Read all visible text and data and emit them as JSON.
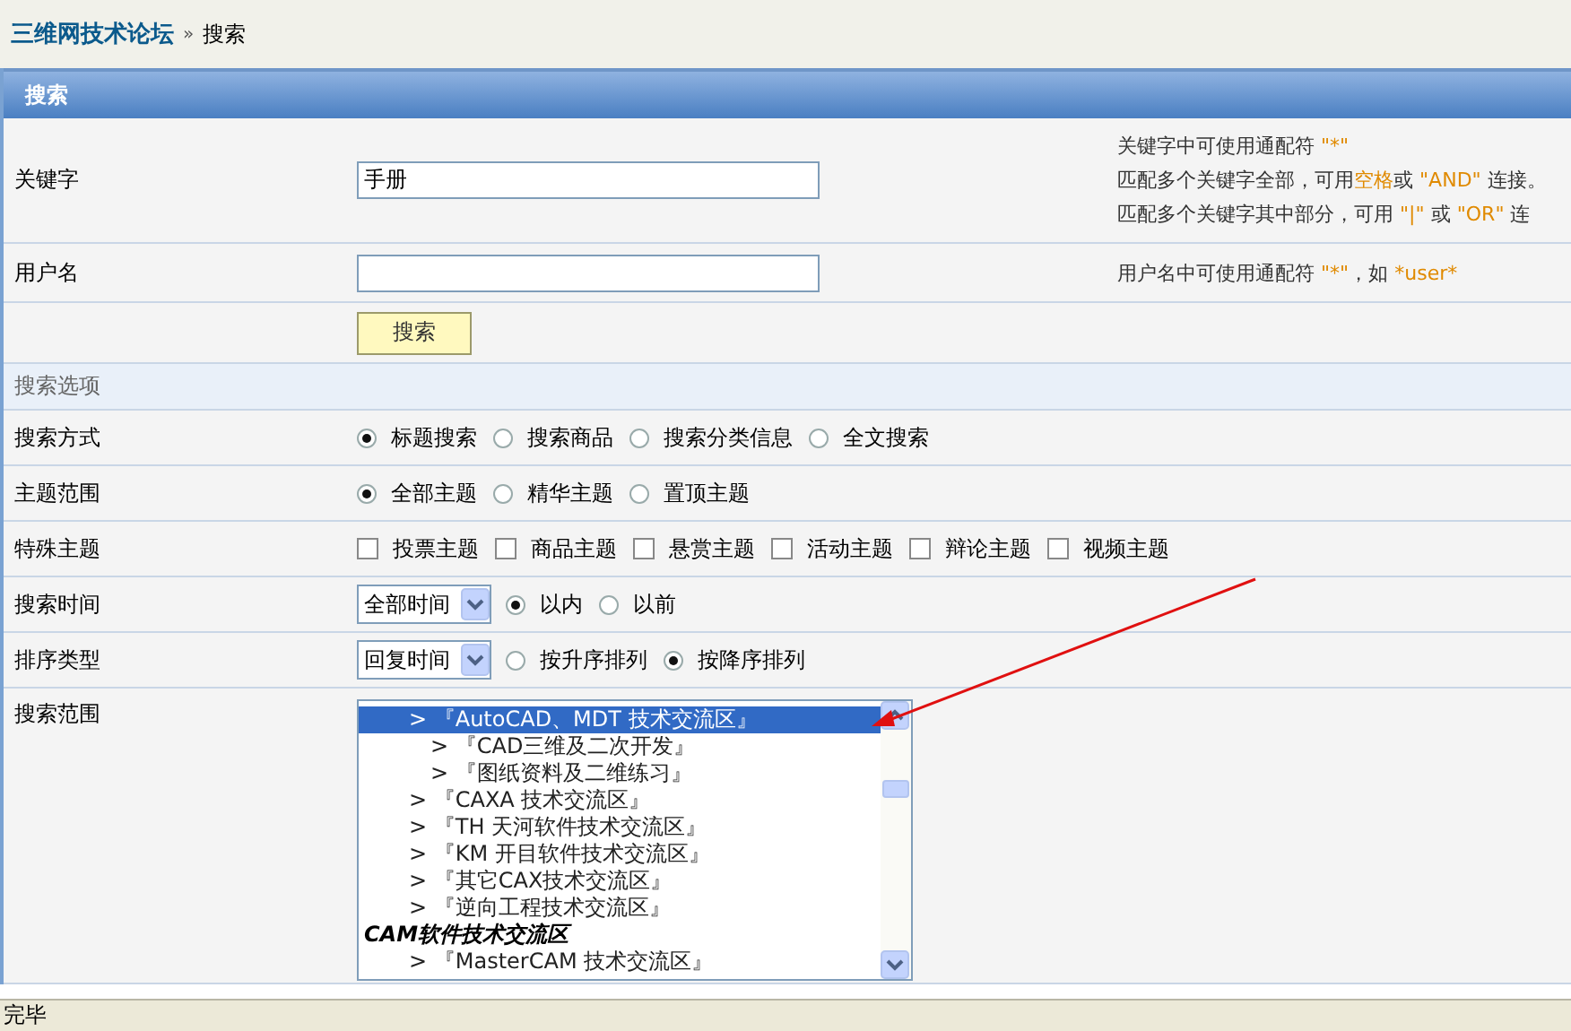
{
  "breadcrumb": {
    "site": "三维网技术论坛",
    "separator": "»",
    "current": "搜索"
  },
  "panel": {
    "title": "搜索"
  },
  "keyword": {
    "label": "关键字",
    "value": "手册",
    "hints": [
      [
        {
          "text": "关键字中可使用通配符 ",
          "highlight": false
        },
        {
          "text": "\"*\"",
          "highlight": true
        }
      ],
      [
        {
          "text": "匹配多个关键字全部，可用",
          "highlight": false
        },
        {
          "text": "空格",
          "highlight": true
        },
        {
          "text": "或 ",
          "highlight": false
        },
        {
          "text": "\"AND\"",
          "highlight": true
        },
        {
          "text": " 连接。",
          "highlight": false
        }
      ],
      [
        {
          "text": "匹配多个关键字其中部分，可用 ",
          "highlight": false
        },
        {
          "text": "\"|\"",
          "highlight": true
        },
        {
          "text": " 或 ",
          "highlight": false
        },
        {
          "text": "\"OR\"",
          "highlight": true
        },
        {
          "text": " 连",
          "highlight": false
        }
      ]
    ]
  },
  "username": {
    "label": "用户名",
    "hints": [
      [
        {
          "text": "用户名中可使用通配符 ",
          "highlight": false
        },
        {
          "text": "\"*\"",
          "highlight": true
        },
        {
          "text": "，如 ",
          "highlight": false
        },
        {
          "text": "*user*",
          "highlight": true
        }
      ]
    ]
  },
  "search_button": "搜索",
  "options": {
    "title": "搜索选项",
    "rows": [
      {
        "label": "搜索方式",
        "kind": "radio",
        "choices": [
          {
            "label": "标题搜索",
            "selected": true
          },
          {
            "label": "搜索商品",
            "selected": false
          },
          {
            "label": "搜索分类信息",
            "selected": false
          },
          {
            "label": "全文搜索",
            "selected": false
          }
        ]
      },
      {
        "label": "主题范围",
        "kind": "radio",
        "choices": [
          {
            "label": "全部主题",
            "selected": true
          },
          {
            "label": "精华主题",
            "selected": false
          },
          {
            "label": "置顶主题",
            "selected": false
          }
        ]
      },
      {
        "label": "特殊主题",
        "kind": "checkbox",
        "choices": [
          {
            "label": "投票主题",
            "checked": false
          },
          {
            "label": "商品主题",
            "checked": false
          },
          {
            "label": "悬赏主题",
            "checked": false
          },
          {
            "label": "活动主题",
            "checked": false
          },
          {
            "label": "辩论主题",
            "checked": false
          },
          {
            "label": "视频主题",
            "checked": false
          }
        ]
      },
      {
        "label": "搜索时间",
        "kind": "select-radio",
        "select": "全部时间",
        "choices": [
          {
            "label": "以内",
            "selected": true
          },
          {
            "label": "以前",
            "selected": false
          }
        ]
      },
      {
        "label": "排序类型",
        "kind": "select-radio",
        "select": "回复时间",
        "choices": [
          {
            "label": "按升序排列",
            "selected": false
          },
          {
            "label": "按降序排列",
            "selected": true
          }
        ]
      },
      {
        "label": "搜索范围",
        "kind": "listbox",
        "items": [
          {
            "text": "> 『AutoCAD、MDT 技术交流区』",
            "kind": "option",
            "selected": true,
            "children": [
              {
                "text": "> 『CAD三维及二次开发』",
                "kind": "option",
                "selected": false
              },
              {
                "text": "> 『图纸资料及二维练习』",
                "kind": "option",
                "selected": false
              }
            ]
          },
          {
            "text": "> 『CAXA 技术交流区』",
            "kind": "option",
            "selected": false
          },
          {
            "text": "> 『TH 天河软件技术交流区』",
            "kind": "option",
            "selected": false
          },
          {
            "text": "> 『KM 开目软件技术交流区』",
            "kind": "option",
            "selected": false
          },
          {
            "text": "> 『其它CAX技术交流区』",
            "kind": "option",
            "selected": false
          },
          {
            "text": "> 『逆向工程技术交流区』",
            "kind": "option",
            "selected": false
          },
          {
            "text": "CAM软件技术交流区",
            "kind": "group",
            "children": [
              {
                "text": "> 『MasterCAM 技术交流区』",
                "kind": "option",
                "selected": false
              }
            ]
          }
        ]
      }
    ]
  },
  "status_bar": "完毕"
}
